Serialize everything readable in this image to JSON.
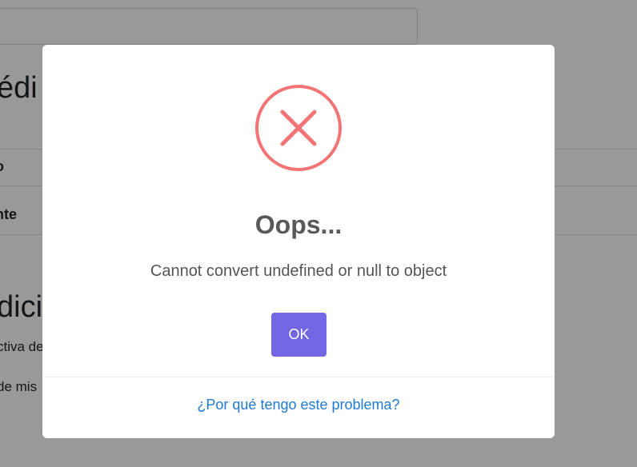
{
  "background": {
    "heading_1": "édi",
    "row_1_text": "o",
    "row_2_text": "nte",
    "heading_2": "dicio",
    "paragraph_1": "ctiva de",
    "paragraph_2": "de mis"
  },
  "modal": {
    "icon": "error-x-icon",
    "title": "Oops...",
    "message": "Cannot convert undefined or null to object",
    "confirm_label": "OK",
    "footer_link": "¿Por qué tengo este problema?"
  },
  "colors": {
    "icon": "#f27474",
    "confirm_button": "#7366e3",
    "link": "#1e78d4",
    "overlay": "rgba(0,0,0,0.4)"
  }
}
